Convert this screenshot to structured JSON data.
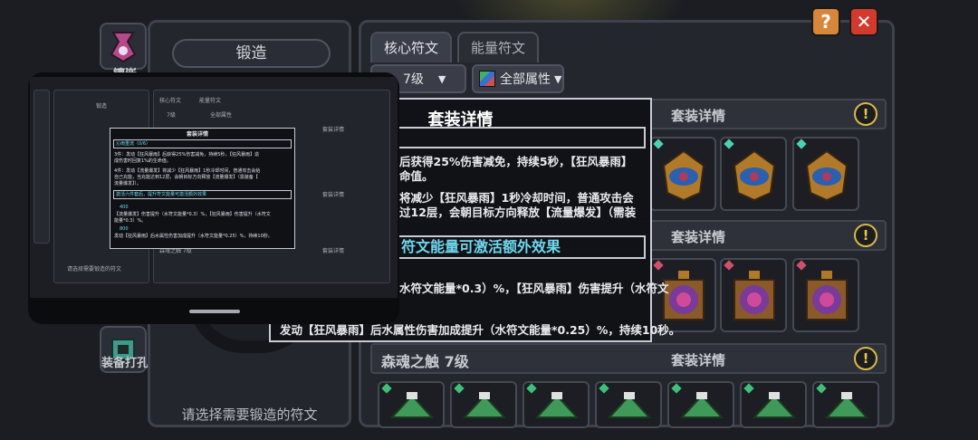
{
  "left_sidebar": {
    "top_label": "镶嵌",
    "bottom_label": "装备打孔"
  },
  "forge": {
    "title": "锻造",
    "hint": "请选择需要锻造的符文"
  },
  "tabs": {
    "core": "核心符文",
    "energy": "能量符文"
  },
  "filters": {
    "level": "7级",
    "attribute": "全部属性"
  },
  "buttons": {
    "help": "?",
    "close": "✕",
    "info": "!"
  },
  "sets": [
    {
      "name": "",
      "detail": "套装详情"
    },
    {
      "name": "",
      "detail": "套装详情"
    },
    {
      "name": "森魂之触 7级",
      "detail": "套装详情"
    }
  ],
  "tooltip": {
    "title": "套装详情",
    "line1": "后获得25%伤害减免，持续5秒，【狂风暴雨】",
    "line2": "命值。",
    "line3": "将减少【狂风暴雨】1秒冷却时间，普通攻击会",
    "line4": "过12层，会朝目标方向释放【流量爆发】（需装",
    "section2": "符文能量可激活额外效果",
    "line5": "水符文能量*0.3）%，【狂风暴雨】伤害提升（水符文",
    "line6": "发动【狂风暴雨】后水属性伤害加成提升（水符文能量*0.25）%，持续10秒。"
  },
  "phone": {
    "forge_title": "锻造",
    "forge_hint": "请选择需要锻造的符文",
    "tab_core": "核心符文",
    "tab_energy": "能量符文",
    "level": "7级",
    "attribute": "全部属性",
    "set_detail": "套装详情",
    "set_name": "森魂之触 7级",
    "tt_title": "套装详情",
    "tt_header": "沁雨重流（0/6）",
    "tt_line1": "3件：发动【狂风暴雨】后获得25%伤害减免，持续5秒，【狂风暴雨】造",
    "tt_line2": "成伤害时回复1%的生命值。",
    "tt_line3": "4件：发动【流量爆发】将减少【狂风暴雨】1秒冷却时间，普通攻击会给",
    "tt_line4": "自己充能，当充能达到12层，会朝目标方向释放【流量爆发】（需装备【",
    "tt_line5": "流量爆发】）。",
    "tt_section": "激活六件套后，提升符文能量可激活额外效果",
    "tt_v1": "400",
    "tt_line6": "【流量爆发】伤害提升（水符文能量*0.3）%，【狂风暴雨】伤害提升（水符文",
    "tt_line7": "能量*0.3）%。",
    "tt_v2": "800",
    "tt_line8": "发动【狂风暴雨】后水属性伤害加成提升（水符文能量*0.25）%，持续10秒。"
  },
  "colors": {
    "gem_green": "#3fbf7a",
    "gem_teal": "#4fd0b0",
    "gem_red": "#d0506a",
    "accent_cyan": "#6fd8ef",
    "close_red": "#d23a2e",
    "help_orange": "#d7873b"
  }
}
